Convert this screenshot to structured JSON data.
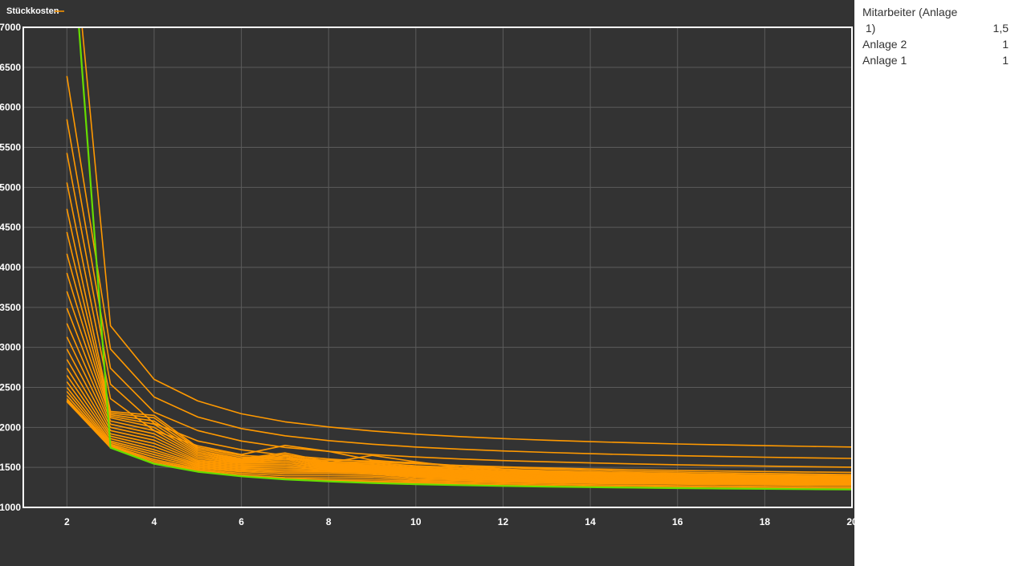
{
  "colors": {
    "background": "#333333",
    "plot_border": "#ffffff",
    "grid": "#5c5c5c",
    "series": "#ff9900",
    "min_series": "#66dd00"
  },
  "chart_data": {
    "type": "line",
    "legend": {
      "label": "Stückkosten",
      "placement": "top-left"
    },
    "xlim": [
      1,
      20
    ],
    "ylim": [
      1000,
      7000
    ],
    "xticks": [
      2,
      4,
      6,
      8,
      10,
      12,
      14,
      16,
      18,
      20
    ],
    "yticks": [
      1000,
      1500,
      2000,
      2500,
      3000,
      3500,
      4000,
      4500,
      5000,
      5500,
      6000,
      6500,
      7000
    ],
    "grid": true,
    "x": [
      2,
      3,
      4,
      5,
      6,
      7,
      8,
      9,
      10,
      11,
      12,
      13,
      14,
      15,
      16,
      17,
      18,
      19,
      20
    ],
    "series": [
      {
        "values": [
          9000,
          3270,
          2600,
          2330,
          2170,
          2070,
          2005,
          1955,
          1915,
          1885,
          1860,
          1840,
          1822,
          1807,
          1793,
          1782,
          1772,
          1763,
          1755
        ]
      },
      {
        "values": [
          6390,
          2980,
          2380,
          2130,
          1985,
          1895,
          1835,
          1790,
          1755,
          1728,
          1705,
          1687,
          1671,
          1658,
          1646,
          1636,
          1627,
          1619,
          1612
        ]
      },
      {
        "values": [
          5850,
          2740,
          2190,
          1960,
          1830,
          1750,
          1700,
          1660,
          1630,
          1605,
          1585,
          1570,
          1556,
          1544,
          1533,
          1524,
          1516,
          1509,
          1503
        ]
      },
      {
        "values": [
          5430,
          2540,
          2050,
          1830,
          1720,
          1650,
          1605,
          1570,
          1545,
          1525,
          1508,
          1494,
          1482,
          1472,
          1463,
          1455,
          1448,
          1442,
          1437
        ]
      },
      {
        "values": [
          5060,
          2360,
          1960,
          1770,
          1660,
          1775,
          1700,
          1590,
          1550,
          1520,
          1500,
          1480,
          1465,
          1453,
          1442,
          1432,
          1424,
          1417,
          1410
        ]
      },
      {
        "values": [
          4730,
          2200,
          2150,
          1750,
          1650,
          1620,
          1560,
          1650,
          1570,
          1500,
          1478,
          1460,
          1446,
          1434,
          1424,
          1415,
          1407,
          1400,
          1394
        ]
      },
      {
        "values": [
          4440,
          2180,
          2120,
          1730,
          1630,
          1600,
          1590,
          1580,
          1560,
          1520,
          1480,
          1450,
          1435,
          1422,
          1412,
          1403,
          1395,
          1388,
          1382
        ]
      },
      {
        "values": [
          4170,
          2160,
          2080,
          1710,
          1610,
          1680,
          1570,
          1560,
          1520,
          1500,
          1470,
          1440,
          1425,
          1412,
          1402,
          1393,
          1385,
          1378,
          1372
        ]
      },
      {
        "values": [
          3930,
          2140,
          2040,
          1690,
          1600,
          1660,
          1555,
          1545,
          1505,
          1485,
          1455,
          1430,
          1416,
          1403,
          1393,
          1384,
          1376,
          1369,
          1363
        ]
      },
      {
        "values": [
          3700,
          2120,
          2000,
          1670,
          1590,
          1640,
          1545,
          1530,
          1492,
          1470,
          1443,
          1421,
          1408,
          1396,
          1386,
          1377,
          1369,
          1362,
          1356
        ]
      },
      {
        "values": [
          3490,
          2080,
          1960,
          1650,
          1580,
          1620,
          1535,
          1518,
          1480,
          1458,
          1432,
          1413,
          1400,
          1389,
          1379,
          1370,
          1363,
          1356,
          1350
        ]
      },
      {
        "values": [
          3300,
          2040,
          1920,
          1630,
          1570,
          1600,
          1525,
          1506,
          1470,
          1447,
          1423,
          1405,
          1393,
          1382,
          1373,
          1364,
          1357,
          1350,
          1344
        ]
      },
      {
        "values": [
          3130,
          2000,
          1880,
          1610,
          1560,
          1580,
          1515,
          1495,
          1460,
          1437,
          1414,
          1398,
          1386,
          1376,
          1367,
          1358,
          1351,
          1345,
          1339
        ]
      },
      {
        "values": [
          2980,
          1960,
          1840,
          1590,
          1550,
          1560,
          1505,
          1485,
          1450,
          1428,
          1406,
          1391,
          1379,
          1369,
          1361,
          1353,
          1346,
          1340,
          1334
        ]
      },
      {
        "values": [
          2850,
          1920,
          1800,
          1575,
          1535,
          1540,
          1495,
          1475,
          1440,
          1419,
          1398,
          1384,
          1372,
          1363,
          1355,
          1347,
          1341,
          1335,
          1329
        ]
      },
      {
        "values": [
          2740,
          1890,
          1760,
          1560,
          1520,
          1520,
          1485,
          1466,
          1430,
          1410,
          1390,
          1377,
          1366,
          1357,
          1349,
          1342,
          1336,
          1330,
          1325
        ]
      },
      {
        "values": [
          2650,
          1860,
          1720,
          1545,
          1505,
          1500,
          1475,
          1456,
          1420,
          1401,
          1383,
          1370,
          1360,
          1351,
          1344,
          1337,
          1331,
          1325,
          1320
        ]
      },
      {
        "values": [
          2570,
          1830,
          1690,
          1530,
          1490,
          1480,
          1465,
          1446,
          1410,
          1392,
          1376,
          1363,
          1353,
          1345,
          1338,
          1331,
          1325,
          1320,
          1315
        ]
      },
      {
        "values": [
          2500,
          1810,
          1660,
          1515,
          1475,
          1460,
          1452,
          1436,
          1400,
          1383,
          1368,
          1356,
          1346,
          1339,
          1332,
          1325,
          1320,
          1315,
          1310
        ]
      },
      {
        "values": [
          2450,
          1790,
          1630,
          1500,
          1460,
          1440,
          1440,
          1425,
          1390,
          1374,
          1360,
          1349,
          1339,
          1332,
          1326,
          1320,
          1315,
          1310,
          1305
        ]
      },
      {
        "values": [
          2400,
          1775,
          1600,
          1485,
          1445,
          1420,
          1420,
          1410,
          1378,
          1364,
          1351,
          1341,
          1332,
          1325,
          1319,
          1313,
          1309,
          1304,
          1300
        ]
      },
      {
        "values": [
          2360,
          1765,
          1580,
          1470,
          1425,
          1395,
          1395,
          1390,
          1362,
          1352,
          1341,
          1332,
          1324,
          1317,
          1311,
          1306,
          1302,
          1297,
          1293
        ]
      },
      {
        "values": [
          2340,
          1755,
          1560,
          1460,
          1405,
          1370,
          1368,
          1370,
          1345,
          1338,
          1328,
          1319,
          1312,
          1306,
          1300,
          1296,
          1292,
          1287,
          1284
        ]
      },
      {
        "values": [
          2330,
          1750,
          1550,
          1452,
          1395,
          1358,
          1345,
          1345,
          1330,
          1322,
          1314,
          1306,
          1300,
          1295,
          1290,
          1286,
          1282,
          1278,
          1275
        ]
      },
      {
        "values": [
          2325,
          1748,
          1548,
          1448,
          1391,
          1354,
          1335,
          1325,
          1316,
          1306,
          1298,
          1290,
          1283,
          1277,
          1272,
          1267,
          1263,
          1259,
          1255
        ]
      },
      {
        "values": [
          2322,
          1746,
          1546,
          1446,
          1389,
          1352,
          1332,
          1318,
          1305,
          1292,
          1282,
          1274,
          1267,
          1261,
          1255,
          1250,
          1246,
          1242,
          1238
        ]
      }
    ],
    "min_series": {
      "values": [
        9000,
        1745,
        1545,
        1445,
        1388,
        1350,
        1325,
        1305,
        1290,
        1278,
        1268,
        1260,
        1253,
        1247,
        1241,
        1236,
        1232,
        1228,
        1225
      ]
    }
  },
  "side_panel": {
    "params": [
      {
        "label": "Mitarbeiter (Anlage",
        "value": ""
      },
      {
        "label": " 1)",
        "value": "1,5"
      },
      {
        "label": "Anlage 2",
        "value": "1"
      },
      {
        "label": "Anlage 1",
        "value": "1"
      }
    ]
  }
}
